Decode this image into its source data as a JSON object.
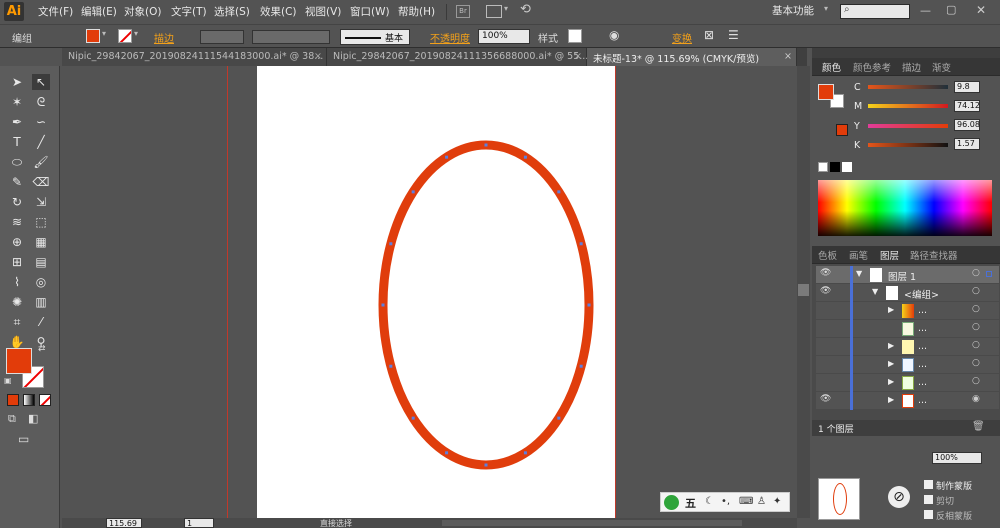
{
  "app": {
    "logo": "Ai"
  },
  "menu": [
    "文件(F)",
    "编辑(E)",
    "对象(O)",
    "文字(T)",
    "选择(S)",
    "效果(C)",
    "视图(V)",
    "窗口(W)",
    "帮助(H)"
  ],
  "workspace": {
    "label": "基本功能"
  },
  "control_bar": {
    "selection_label": "编组",
    "stroke_label": "描边",
    "stroke_profile": "基本",
    "opacity_label": "不透明度",
    "opacity_value": "100%",
    "style_label": "样式",
    "transform_label": "变换"
  },
  "tabs": [
    {
      "label": "Nipic_29842067_20190824111544183000.ai* @ 38...",
      "active": false
    },
    {
      "label": "Nipic_29842067_20190824111356688000.ai* @ 55...",
      "active": false
    },
    {
      "label": "未标题-13* @ 115.69% (CMYK/预览)",
      "active": true
    }
  ],
  "colors": {
    "fill": "#e23c0a",
    "ellipse_stroke": "#e03d0c",
    "accent_orange": "#f2a01a"
  },
  "color_panel": {
    "tabs": [
      "颜色",
      "颜色参考",
      "描边",
      "渐变"
    ],
    "channels": [
      {
        "name": "C",
        "value": "9.8"
      },
      {
        "name": "M",
        "value": "74.12"
      },
      {
        "name": "Y",
        "value": "96.08"
      },
      {
        "name": "K",
        "value": "1.57"
      }
    ]
  },
  "layers_panel": {
    "tabs": [
      "色板",
      "画笔",
      "图层",
      "路径查找器"
    ],
    "layer_name": "图层 1",
    "group_name": "<编组>",
    "sub_item_label": "...",
    "count_label": "1 个图层"
  },
  "bottom_panel": {
    "opacity_value": "100%",
    "make_mask": "制作蒙版",
    "clip": "剪切",
    "invert_mask": "反相蒙版"
  },
  "status": {
    "zoom": "115.69",
    "page": "1",
    "tool_name": "直接选择"
  },
  "ime": {
    "label": "五"
  }
}
